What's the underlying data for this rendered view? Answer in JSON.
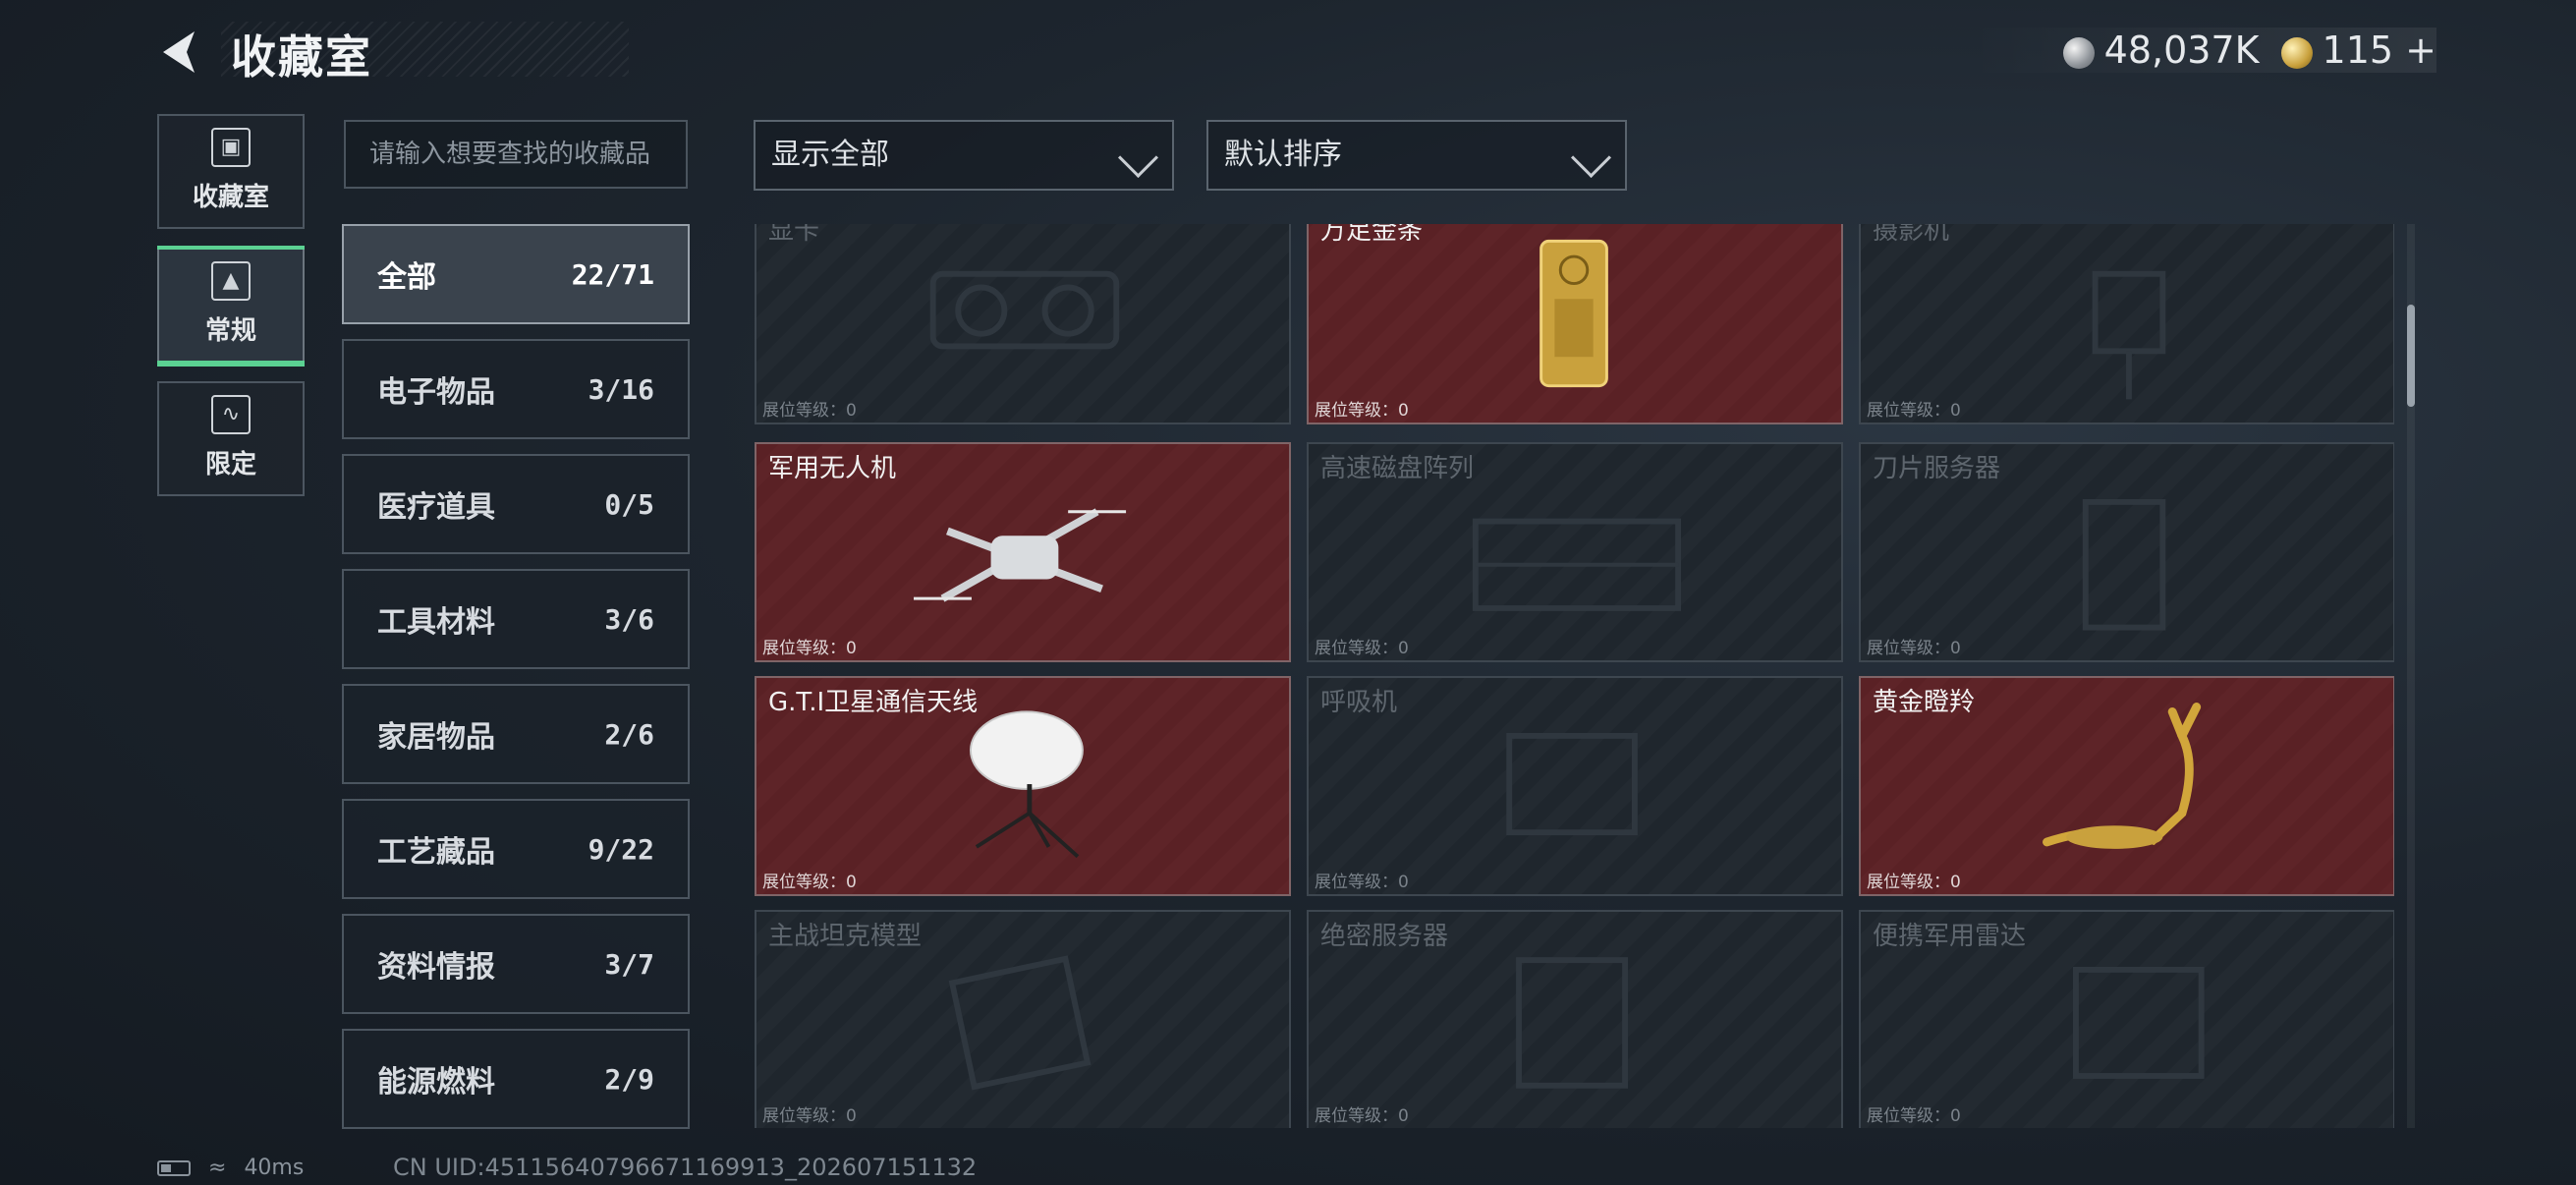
{
  "header": {
    "title": "收藏室",
    "currency_silver": "48,037K",
    "currency_gold": "115",
    "currency_add": "+"
  },
  "side_tabs": [
    {
      "label": "收藏室",
      "icon": "display-case-icon"
    },
    {
      "label": "常规",
      "icon": "image-frame-icon",
      "active": true
    },
    {
      "label": "限定",
      "icon": "limited-icon"
    }
  ],
  "search": {
    "placeholder": "请输入想要查找的收藏品"
  },
  "filters": {
    "show": "显示全部",
    "sort": "默认排序"
  },
  "categories": [
    {
      "label": "全部",
      "count": "22/71",
      "active": true
    },
    {
      "label": "电子物品",
      "count": "3/16"
    },
    {
      "label": "医疗道具",
      "count": "0/5"
    },
    {
      "label": "工具材料",
      "count": "3/6"
    },
    {
      "label": "家居物品",
      "count": "2/6"
    },
    {
      "label": "工艺藏品",
      "count": "9/22"
    },
    {
      "label": "资料情报",
      "count": "3/7"
    },
    {
      "label": "能源燃料",
      "count": "2/9"
    }
  ],
  "items": [
    {
      "name": "显卡",
      "level": "展位等级：0",
      "owned": false
    },
    {
      "name": "万足金条",
      "level": "展位等级：0",
      "owned": true
    },
    {
      "name": "摄影机",
      "level": "展位等级：0",
      "owned": false
    },
    {
      "name": "军用无人机",
      "level": "展位等级：0",
      "owned": true
    },
    {
      "name": "高速磁盘阵列",
      "level": "展位等级：0",
      "owned": false
    },
    {
      "name": "刀片服务器",
      "level": "展位等级：0",
      "owned": false
    },
    {
      "name": "G.T.I卫星通信天线",
      "level": "展位等级：0",
      "owned": true
    },
    {
      "name": "呼吸机",
      "level": "展位等级：0",
      "owned": false
    },
    {
      "name": "黄金瞪羚",
      "level": "展位等级：0",
      "owned": true
    },
    {
      "name": "主战坦克模型",
      "level": "展位等级：0",
      "owned": false
    },
    {
      "name": "绝密服务器",
      "level": "展位等级：0",
      "owned": false
    },
    {
      "name": "便携军用雷达",
      "level": "展位等级：0",
      "owned": false
    }
  ],
  "status": {
    "ping": "40ms",
    "uid": "CN UID:45115640796671169913_202607151132"
  },
  "colors": {
    "accent_green": "#5bd192",
    "owned_bg": "#5a2125",
    "gold": "#c9a13d"
  }
}
